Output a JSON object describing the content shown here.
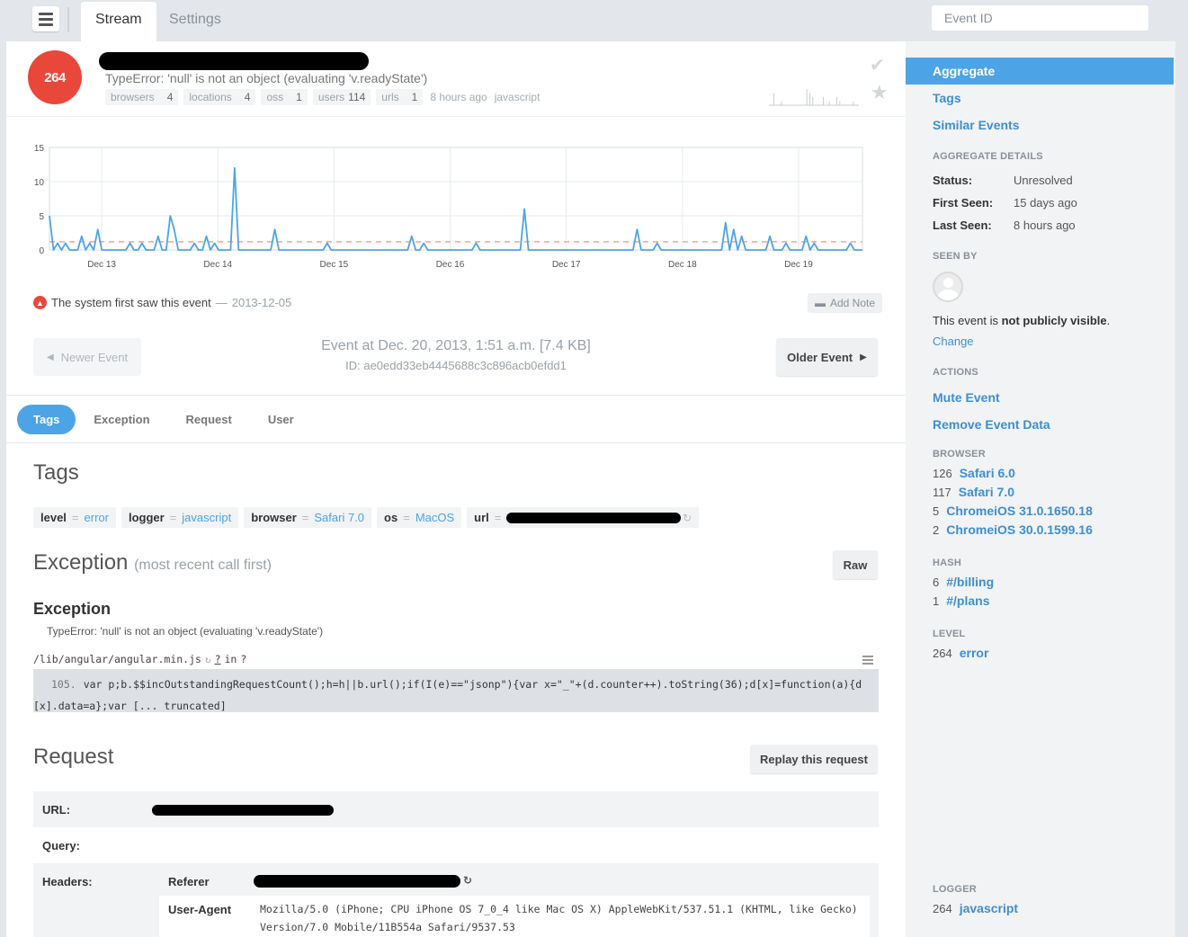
{
  "topbar": {
    "tabs": [
      {
        "label": "Stream",
        "active": true
      },
      {
        "label": "Settings",
        "active": false
      }
    ],
    "event_id_placeholder": "Event ID"
  },
  "event": {
    "count": "264",
    "message": "TypeError: 'null' is not an object (evaluating 'v.readyState')",
    "meta": [
      {
        "label": "browsers",
        "count": "4"
      },
      {
        "label": "locations",
        "count": "4"
      },
      {
        "label": "oss",
        "count": "1"
      },
      {
        "label": "users",
        "count": "114"
      },
      {
        "label": "urls",
        "count": "1"
      }
    ],
    "time_ago": "8 hours ago",
    "platform": "javascript"
  },
  "chart_data": {
    "type": "line",
    "yticks": [
      0,
      5,
      10,
      15
    ],
    "ylim": [
      0,
      15
    ],
    "xticks": [
      "Dec 13",
      "Dec 14",
      "Dec 15",
      "Dec 16",
      "Dec 17",
      "Dec 18",
      "Dec 19"
    ],
    "grid": true,
    "series_color": "#4ca4e6",
    "avg_line": {
      "value": 1.2,
      "color": "#f4a39b"
    },
    "values": [
      5,
      0,
      1,
      0,
      1,
      0,
      0,
      0,
      2,
      0,
      1,
      0,
      3,
      0,
      0,
      0,
      0,
      0,
      0,
      0,
      1,
      0,
      0,
      1,
      0,
      0,
      0,
      2,
      0,
      0,
      5,
      3,
      0,
      0,
      0,
      0,
      1,
      0,
      0,
      2,
      0,
      1,
      0,
      0,
      0,
      0,
      12,
      0,
      0,
      0,
      0,
      0,
      0,
      0,
      0,
      0,
      3,
      0,
      0,
      0,
      0,
      0,
      0,
      0,
      0,
      0,
      0,
      0,
      0,
      1,
      0,
      0,
      0,
      0,
      0,
      0,
      0,
      0,
      0,
      0,
      0,
      0,
      0,
      0,
      0,
      0,
      0,
      0,
      0,
      0,
      2,
      0,
      0,
      1,
      0,
      0,
      0,
      0,
      0,
      0,
      0,
      0,
      0,
      0,
      0,
      0,
      1,
      0,
      0,
      0,
      0,
      0,
      0,
      0,
      0,
      0,
      0,
      0,
      6,
      0,
      0,
      0,
      0,
      0,
      0,
      0,
      0,
      0,
      0,
      0,
      0,
      0,
      0,
      0,
      0,
      0,
      0,
      0,
      0,
      0,
      0,
      0,
      0,
      0,
      0,
      0,
      3,
      0,
      0,
      0,
      0,
      1,
      0,
      0,
      0,
      0,
      0,
      0,
      0,
      0,
      0,
      0,
      0,
      0,
      0,
      0,
      0,
      0,
      4,
      0,
      3,
      0,
      2,
      0,
      0,
      0,
      0,
      0,
      0,
      2,
      0,
      0,
      0,
      1,
      0,
      0,
      0,
      0,
      2,
      0,
      1,
      0,
      0,
      0,
      0,
      0,
      0,
      0,
      0,
      1,
      0,
      0,
      0
    ]
  },
  "first_seen": {
    "text": "The system first saw this event",
    "sep": "—",
    "date": "2013-12-05",
    "add_note": "Add Note"
  },
  "nav": {
    "newer": "Newer Event",
    "older": "Older Event",
    "event_at": "Event at Dec. 20, 2013, 1:51 a.m. [7.4 KB]",
    "event_id": "ID: ae0edd33eb4445688c3c896acb0efdd1"
  },
  "detail_tabs": [
    {
      "label": "Tags",
      "active": true
    },
    {
      "label": "Exception",
      "active": false
    },
    {
      "label": "Request",
      "active": false
    },
    {
      "label": "User",
      "active": false
    }
  ],
  "tags_section": {
    "title": "Tags",
    "tags": [
      {
        "key": "level",
        "value": "error"
      },
      {
        "key": "logger",
        "value": "javascript"
      },
      {
        "key": "browser",
        "value": "Safari 7.0"
      },
      {
        "key": "os",
        "value": "MacOS"
      },
      {
        "key": "url",
        "value": ""
      }
    ],
    "eq": "="
  },
  "exception_section": {
    "title": "Exception",
    "subtitle": "(most recent call first)",
    "raw_label": "Raw",
    "exc_title": "Exception",
    "exc_message": "TypeError: 'null' is not an object (evaluating 'v.readyState')",
    "frame_path": "/lib/angular/angular.min.js",
    "frame_loc": "?",
    "frame_in": "in",
    "frame_fn": "?",
    "line_no": "105.",
    "code_line1": "var p;b.$$incOutstandingRequestCount();h=h||b.url();if(I(e)==\"jsonp\"){var x=\"_\"+(d.counter++).toString(36);d[x]=function(a){d",
    "code_line2": "[x].data=a};var [... truncated]"
  },
  "request_section": {
    "title": "Request",
    "replay_label": "Replay this request",
    "url_label": "URL:",
    "query_label": "Query:",
    "headers_label": "Headers:",
    "headers": [
      {
        "key": "Referer",
        "value": ""
      },
      {
        "key": "User-Agent",
        "value": "Mozilla/5.0 (iPhone; CPU iPhone OS 7_0_4 like Mac OS X) AppleWebKit/537.51.1 (KHTML, like Gecko) Version/7.0 Mobile/11B554a Safari/9537.53"
      }
    ]
  },
  "sidebar": {
    "nav": [
      "Aggregate",
      "Tags",
      "Similar Events"
    ],
    "aggregate_title": "AGGREGATE DETAILS",
    "details": [
      {
        "k": "Status:",
        "v": "Unresolved"
      },
      {
        "k": "First Seen:",
        "v": "15 days ago"
      },
      {
        "k": "Last Seen:",
        "v": "8 hours ago"
      }
    ],
    "seen_by_title": "SEEN BY",
    "visibility_prefix": "This event is",
    "visibility_bold": "not publicly visible",
    "visibility_suffix": ".",
    "change_label": "Change",
    "actions_title": "ACTIONS",
    "actions": [
      "Mute Event",
      "Remove Event Data"
    ],
    "browser_title": "BROWSER",
    "browsers": [
      {
        "n": "126",
        "l": "Safari 6.0"
      },
      {
        "n": "117",
        "l": "Safari 7.0"
      },
      {
        "n": "5",
        "l": "ChromeiOS 31.0.1650.18"
      },
      {
        "n": "2",
        "l": "ChromeiOS 30.0.1599.16"
      }
    ],
    "hash_title": "HASH",
    "hashes": [
      {
        "n": "6",
        "l": "#/billing"
      },
      {
        "n": "1",
        "l": "#/plans"
      }
    ],
    "level_title": "LEVEL",
    "levels": [
      {
        "n": "264",
        "l": "error"
      }
    ],
    "logger_title": "LOGGER",
    "loggers": [
      {
        "n": "264",
        "l": "javascript"
      }
    ]
  }
}
